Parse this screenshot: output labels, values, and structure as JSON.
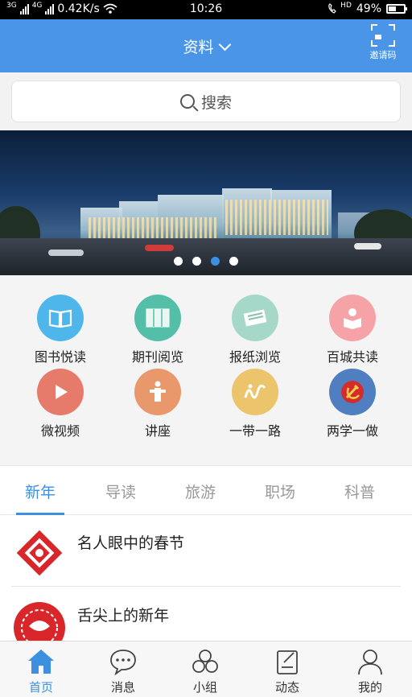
{
  "status_bar": {
    "network_left": "3G",
    "network_4g": "4G",
    "speed": "0.42K/s",
    "time": "10:26",
    "volte": "HD",
    "battery": "49%"
  },
  "header": {
    "title": "资料",
    "invite_label": "邀请码"
  },
  "search": {
    "placeholder": "搜索"
  },
  "banner": {
    "slide_count": 4,
    "active_slide": 3
  },
  "grid": {
    "items": [
      {
        "label": "图书悦读",
        "icon": "book-icon",
        "color": "#4fb6ec"
      },
      {
        "label": "期刊阅览",
        "icon": "magazine-icon",
        "color": "#54bfa9"
      },
      {
        "label": "报纸浏览",
        "icon": "newspaper-icon",
        "color": "#a5d8c8"
      },
      {
        "label": "百城共读",
        "icon": "reader-icon",
        "color": "#f5a3a6"
      },
      {
        "label": "微视频",
        "icon": "play-icon",
        "color": "#e77b6b"
      },
      {
        "label": "讲座",
        "icon": "speaker-icon",
        "color": "#e8986a"
      },
      {
        "label": "一带一路",
        "icon": "belt-road-icon",
        "color": "#ecc46c"
      },
      {
        "label": "两学一做",
        "icon": "party-emblem-icon",
        "color": "#4f7fc0"
      }
    ]
  },
  "tabs": [
    "新年",
    "导读",
    "旅游",
    "职场",
    "科普"
  ],
  "active_tab": 0,
  "articles": [
    {
      "title": "名人眼中的春节",
      "thumb": "paper-cut-fu-icon"
    },
    {
      "title": "舌尖上的新年",
      "thumb": "paper-cut-circle-icon"
    }
  ],
  "nav": [
    {
      "label": "首页",
      "icon": "home-icon"
    },
    {
      "label": "消息",
      "icon": "message-icon"
    },
    {
      "label": "小组",
      "icon": "group-icon"
    },
    {
      "label": "动态",
      "icon": "feed-icon"
    },
    {
      "label": "我的",
      "icon": "profile-icon"
    }
  ],
  "active_nav": 0,
  "colors": {
    "primary": "#4a95e8",
    "accent": "#3d8fe0"
  }
}
